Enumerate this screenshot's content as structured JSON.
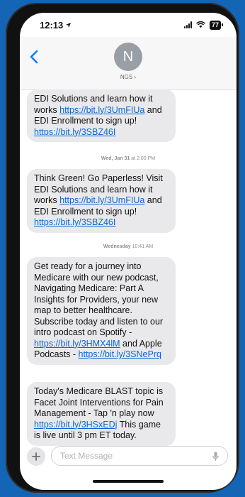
{
  "status_bar": {
    "time": "12:13",
    "battery": "77"
  },
  "header": {
    "avatar_initial": "N",
    "contact_name": "NGS ›"
  },
  "messages": [
    {
      "parts": [
        {
          "text": "EDI Solutions and learn how it works "
        },
        {
          "text": "https://bit.ly/3UmFIUa",
          "link": true
        },
        {
          "text": " and EDI Enrollment to sign up! "
        },
        {
          "text": "https://bit.ly/3SBZ46I",
          "link": true
        }
      ]
    },
    {
      "parts": [
        {
          "text": "Think Green! Go Paperless! Visit EDI Solutions and learn how it works "
        },
        {
          "text": "https://bit.ly/3UmFIUa",
          "link": true
        },
        {
          "text": " and EDI Enrollment to sign up! "
        },
        {
          "text": "https://bit.ly/3SBZ46I",
          "link": true
        }
      ]
    },
    {
      "parts": [
        {
          "text": "Get ready for a journey into Medicare with our new podcast, Navigating Medicare: Part A Insights for Providers, your new map to better healthcare. Subscribe today and listen to our intro podcast on Spotify - "
        },
        {
          "text": "https://bit.ly/3HMX4lM",
          "link": true
        },
        {
          "text": " and Apple Podcasts - "
        },
        {
          "text": "https://bit.ly/3SNePrq",
          "link": true
        }
      ]
    },
    {
      "parts": [
        {
          "text": "Today's Medicare BLAST topic is Facet Joint Interventions for Pain Management - Tap 'n play now "
        },
        {
          "text": "https://bit.ly/3HSxEDj",
          "link": true
        },
        {
          "text": " This game is live until 3 pm ET today."
        }
      ]
    }
  ],
  "timestamps": [
    {
      "day": "Wed, Jan 31",
      "time": "at 2:00 PM"
    },
    {
      "day": "Wednesday",
      "time": "10:41 AM"
    }
  ],
  "input": {
    "placeholder": "Text Message"
  },
  "colors": {
    "background": "#1565b6",
    "bubble": "#e9e9eb",
    "link": "#0a67d6",
    "accent": "#0a7aff"
  }
}
